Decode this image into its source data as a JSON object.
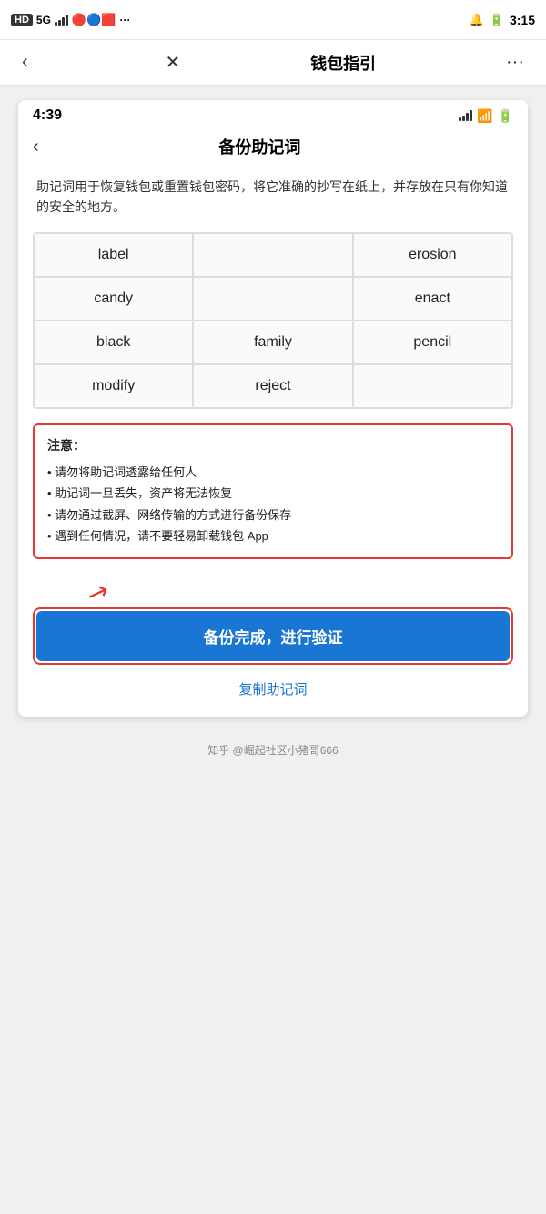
{
  "outer_status_bar": {
    "left_text": "HD 5G",
    "time": "3:15",
    "bell_icon": "🔔"
  },
  "outer_nav": {
    "back_label": "‹",
    "close_label": "✕",
    "title": "钱包指引",
    "more_label": "···"
  },
  "inner_status_bar": {
    "time": "4:39"
  },
  "inner_nav": {
    "back_label": "‹",
    "title": "备份助记词"
  },
  "description": "助记词用于恢复钱包或重置钱包密码，将它准确的抄写在纸上，并存放在只有你知道的安全的地方。",
  "mnemonic_words": [
    "label",
    "",
    "erosion",
    "candy",
    "",
    "enact",
    "black",
    "family",
    "pencil",
    "modify",
    "reject",
    ""
  ],
  "warning": {
    "title": "注意：",
    "items": [
      "• 请勿将助记词透露给任何人",
      "• 助记词一旦丢失，资产将无法恢复",
      "• 请勿通过截屏、网络传输的方式进行备份保存",
      "• 遇到任何情况，请不要轻易卸载钱包 App"
    ]
  },
  "verify_button_label": "备份完成，进行验证",
  "copy_link_label": "复制助记词",
  "bottom_watermark": "知乎 @崛起社区小猪哥666"
}
